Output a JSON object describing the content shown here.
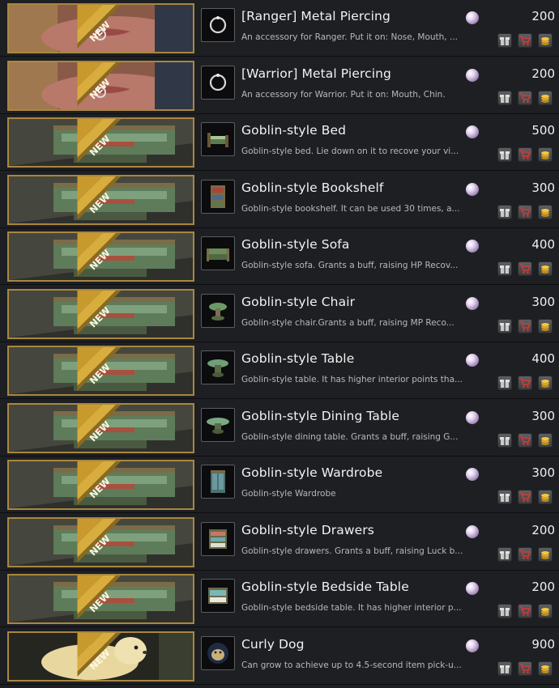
{
  "badge_label": "NEW",
  "currency_icon": "pearl-icon",
  "action_icons": [
    "gift-icon",
    "cart-icon",
    "coin-stack-icon"
  ],
  "items": [
    {
      "name": "[Ranger] Metal Piercing",
      "desc": "An accessory for Ranger. Put it on: Nose, Mouth, ...",
      "price": "200",
      "icon": "piercing-ring-icon",
      "banner": "face"
    },
    {
      "name": "[Warrior] Metal Piercing",
      "desc": "An accessory for Warrior. Put it on: Mouth, Chin.",
      "price": "200",
      "icon": "piercing-ring-icon",
      "banner": "face"
    },
    {
      "name": "Goblin-style Bed",
      "desc": "Goblin-style bed. Lie down on it to recove your vi...",
      "price": "500",
      "icon": "bed-icon",
      "banner": "furniture"
    },
    {
      "name": "Goblin-style Bookshelf",
      "desc": "Goblin-style bookshelf. It can be used 30 times, a...",
      "price": "300",
      "icon": "bookshelf-icon",
      "banner": "furniture"
    },
    {
      "name": "Goblin-style Sofa",
      "desc": "Goblin-style sofa. Grants a buff, raising  HP Recov...",
      "price": "400",
      "icon": "sofa-icon",
      "banner": "furniture"
    },
    {
      "name": "Goblin-style Chair",
      "desc": "Goblin-style chair.Grants a buff, raising  MP Reco...",
      "price": "300",
      "icon": "chair-icon",
      "banner": "furniture"
    },
    {
      "name": "Goblin-style Table",
      "desc": "Goblin-style table. It has higher interior points tha...",
      "price": "400",
      "icon": "table-icon",
      "banner": "furniture"
    },
    {
      "name": "Goblin-style Dining Table",
      "desc": "Goblin-style dining table. Grants a buff, raising G...",
      "price": "300",
      "icon": "dining-table-icon",
      "banner": "furniture"
    },
    {
      "name": "Goblin-style Wardrobe",
      "desc": "Goblin-style Wardrobe",
      "price": "300",
      "icon": "wardrobe-icon",
      "banner": "furniture"
    },
    {
      "name": "Goblin-style Drawers",
      "desc": "Goblin-style drawers. Grants a buff, raising Luck b...",
      "price": "200",
      "icon": "drawers-icon",
      "banner": "furniture"
    },
    {
      "name": "Goblin-style Bedside Table",
      "desc": "Goblin-style bedside table. It has higher interior p...",
      "price": "200",
      "icon": "bedside-table-icon",
      "banner": "furniture"
    },
    {
      "name": "Curly Dog",
      "desc": "Can grow to achieve up to 4.5-second item pick-u...",
      "price": "900",
      "icon": "dog-icon",
      "banner": "pet"
    }
  ]
}
